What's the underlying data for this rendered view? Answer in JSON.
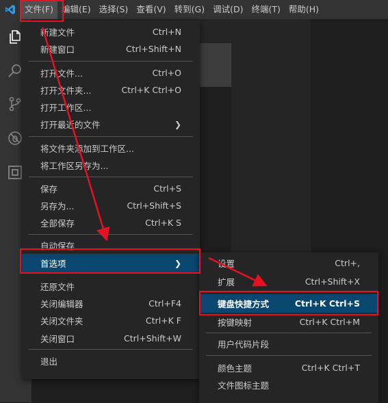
{
  "menubar": {
    "items": [
      "文件(F)",
      "编辑(E)",
      "选择(S)",
      "查看(V)",
      "转到(G)",
      "调试(D)",
      "终端(T)",
      "帮助(H)"
    ]
  },
  "file_menu": [
    {
      "label": "新建文件",
      "shortcut": "Ctrl+N"
    },
    {
      "label": "新建窗口",
      "shortcut": "Ctrl+Shift+N"
    },
    {
      "label": "打开文件...",
      "shortcut": "Ctrl+O"
    },
    {
      "label": "打开文件夹...",
      "shortcut": "Ctrl+K Ctrl+O"
    },
    {
      "label": "打开工作区...",
      "shortcut": ""
    },
    {
      "label": "打开最近的文件",
      "shortcut": ""
    },
    {
      "label": "将文件夹添加到工作区...",
      "shortcut": ""
    },
    {
      "label": "将工作区另存为...",
      "shortcut": ""
    },
    {
      "label": "保存",
      "shortcut": "Ctrl+S"
    },
    {
      "label": "另存为...",
      "shortcut": "Ctrl+Shift+S"
    },
    {
      "label": "全部保存",
      "shortcut": "Ctrl+K S"
    },
    {
      "label": "自动保存",
      "shortcut": ""
    },
    {
      "label": "首选项",
      "shortcut": ""
    },
    {
      "label": "还原文件",
      "shortcut": ""
    },
    {
      "label": "关闭编辑器",
      "shortcut": "Ctrl+F4"
    },
    {
      "label": "关闭文件夹",
      "shortcut": "Ctrl+K F"
    },
    {
      "label": "关闭窗口",
      "shortcut": "Ctrl+Shift+W"
    },
    {
      "label": "退出",
      "shortcut": ""
    }
  ],
  "prefs_menu": [
    {
      "label": "设置",
      "shortcut": "Ctrl+,"
    },
    {
      "label": "扩展",
      "shortcut": "Ctrl+Shift+X"
    },
    {
      "label": "键盘快捷方式",
      "shortcut": "Ctrl+K Ctrl+S"
    },
    {
      "label": "按键映射",
      "shortcut": "Ctrl+K Ctrl+M"
    },
    {
      "label": "用户代码片段",
      "shortcut": ""
    },
    {
      "label": "颜色主题",
      "shortcut": "Ctrl+K Ctrl+T"
    },
    {
      "label": "文件图标主题",
      "shortcut": ""
    }
  ],
  "colors": {
    "highlight": "#e81123",
    "selection": "#094771",
    "logo": "#2f99e6"
  }
}
